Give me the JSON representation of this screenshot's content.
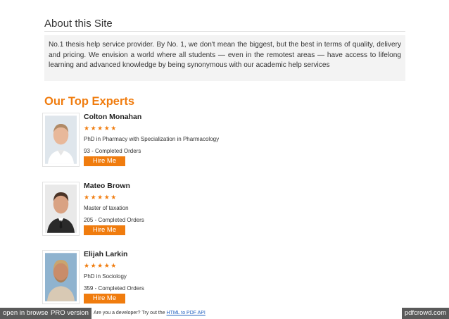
{
  "about": {
    "title": "About this Site",
    "text": "No.1 thesis help service provider. By No. 1, we don't mean the biggest, but the best in terms of quality, delivery and pricing. We envision a world where all students — even in the remotest areas — have access to lifelong learning and advanced knowledge by being synonymous with our academic help services"
  },
  "experts": {
    "title": "Our Top Experts",
    "items": [
      {
        "name": "Colton Monahan",
        "stars": "★★★★★",
        "degree": "PhD in Pharmacy with Specialization in Pharmacology",
        "orders": "93 - Completed Orders",
        "hire_label": "Hire Me"
      },
      {
        "name": "Mateo Brown",
        "stars": "★★★★★",
        "degree": "Master of taxation",
        "orders": "205 - Completed Orders",
        "hire_label": "Hire Me"
      },
      {
        "name": "Elijah Larkin",
        "stars": "★★★★★",
        "degree": "PhD in Sociology",
        "orders": "359 - Completed Orders",
        "hire_label": "Hire Me"
      }
    ]
  },
  "footer": {
    "open_in_browser": "open in browser",
    "pro_version": "PRO version",
    "promo_text": "Are you a developer? Try out the ",
    "promo_link": "HTML to PDF API",
    "brand": "pdfcrowd.com"
  },
  "colors": {
    "accent": "#f07c0e",
    "box_bg": "#f3f3f3",
    "footer_bg": "#5a5a5a",
    "link": "#2060c0"
  }
}
